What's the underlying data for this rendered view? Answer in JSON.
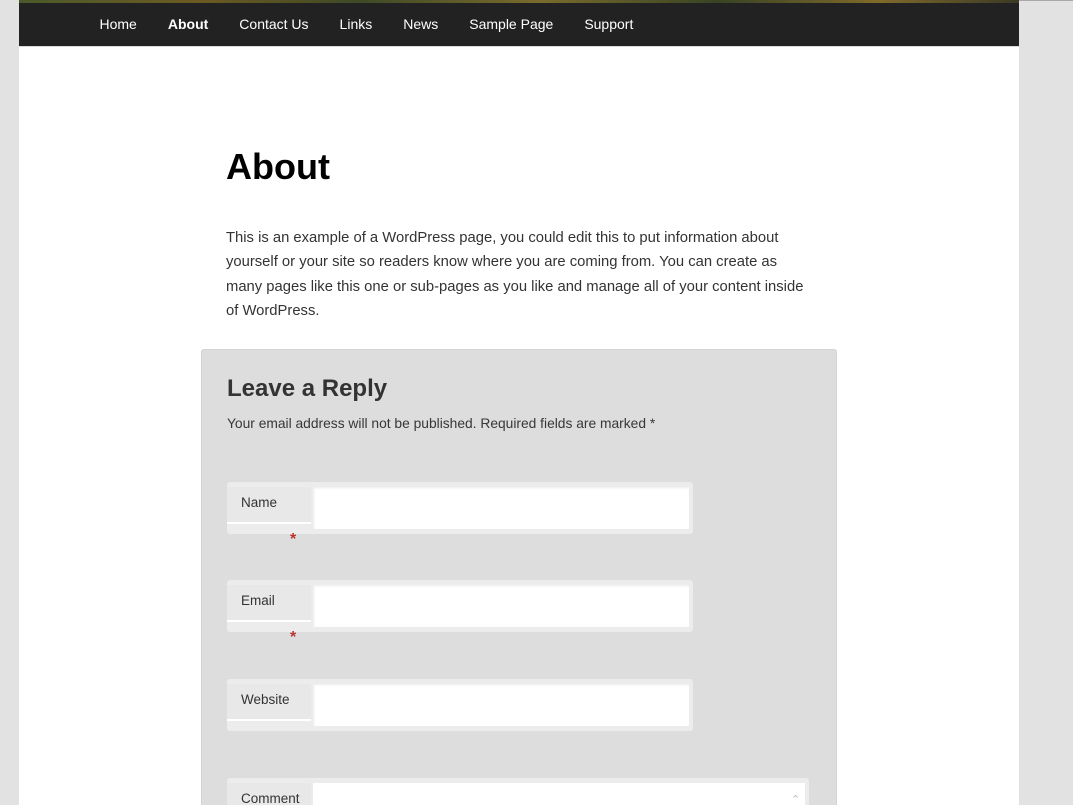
{
  "nav": {
    "items": [
      "Home",
      "About",
      "Contact Us",
      "Links",
      "News",
      "Sample Page",
      "Support"
    ],
    "current": "About"
  },
  "page": {
    "title": "About",
    "body": "This is an example of a WordPress page, you could edit this to put information about yourself or your site so readers know where you are coming from. You can create as many pages like this one or sub-pages as you like and manage all of your content inside of WordPress."
  },
  "comments": {
    "title": "Leave a Reply",
    "notes": "Your email address will not be published. Required fields are marked *",
    "required_mark": "*",
    "fields": {
      "name": {
        "label": "Name",
        "value": ""
      },
      "email": {
        "label": "Email",
        "value": ""
      },
      "website": {
        "label": "Website",
        "value": ""
      },
      "comment": {
        "label": "Comment",
        "value": ""
      }
    }
  },
  "icons": {
    "textarea_resize": "chevron-up-icon"
  },
  "colors": {
    "nav_background": "#222222",
    "required": "#bb3333",
    "comments_background": "#dddddd"
  }
}
